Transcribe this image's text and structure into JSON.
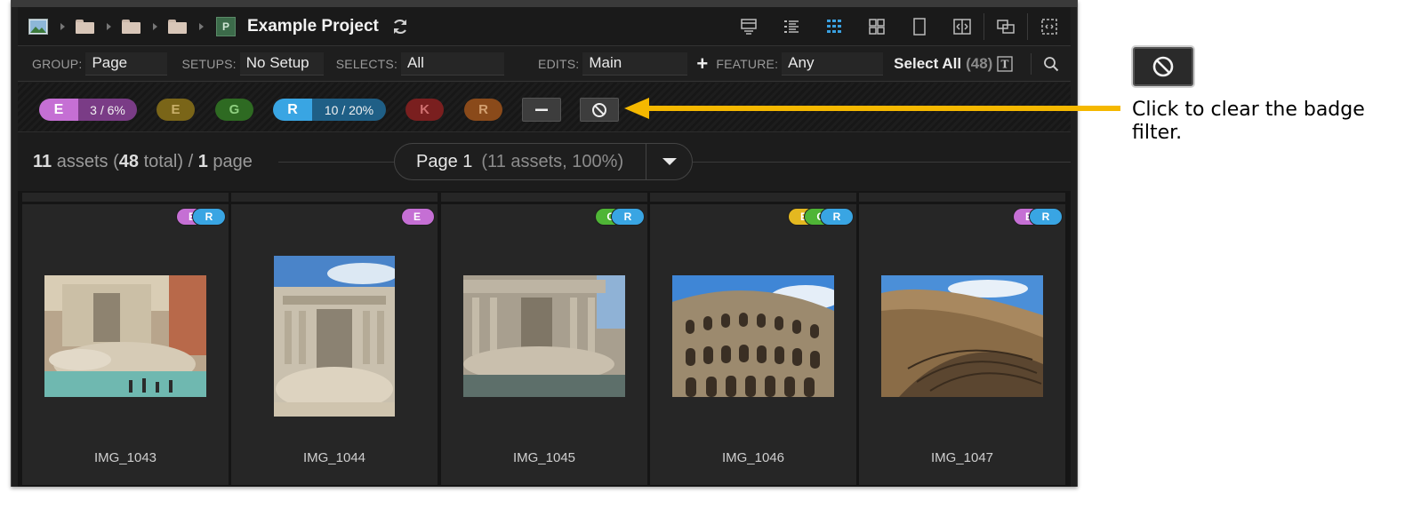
{
  "breadcrumb": {
    "project_badge": "P",
    "title": "Example Project"
  },
  "toolbar": {
    "group_label": "GROUP:",
    "group_value": "Page",
    "setups_label": "SETUPS:",
    "setups_value": "No Setup",
    "selects_label": "SELECTS:",
    "selects_value": "All",
    "edits_label": "EDITS:",
    "edits_value": "Main",
    "plus_label": "+",
    "feature_label": "FEATURE:",
    "feature_value": "Any",
    "select_all_label": "Select All",
    "select_all_count": "(48)",
    "text_icon_label": "T"
  },
  "badge_filters": [
    {
      "letter": "E",
      "stat": "3 / 6%",
      "color": "#c56fd4",
      "dark": "#7a3c86",
      "active": true
    },
    {
      "letter": "E",
      "color": "#7a6518",
      "text_color": "#c9b06a",
      "active": false
    },
    {
      "letter": "G",
      "color": "#2e6a22",
      "text_color": "#8fcf80",
      "active": false
    },
    {
      "letter": "R",
      "stat": "10 / 20%",
      "color": "#39a5e3",
      "dark": "#1f5f86",
      "active": true
    },
    {
      "letter": "K",
      "color": "#7a1f1f",
      "text_color": "#d07070",
      "active": false
    },
    {
      "letter": "R",
      "color": "#8a4a1a",
      "text_color": "#d3a070",
      "active": false
    }
  ],
  "summary": {
    "assets": "11",
    "assets_word": "assets",
    "total": "48",
    "total_word": "total",
    "pages": "1",
    "pages_word": "page"
  },
  "page_selector": {
    "label": "Page 1",
    "info": "(11 assets, 100%)"
  },
  "assets": [
    {
      "name": "IMG_1043",
      "badges": [
        {
          "letter": "E",
          "color": "#c56fd4"
        },
        {
          "letter": "R",
          "color": "#39a5e3"
        }
      ]
    },
    {
      "name": "IMG_1044",
      "badges": [
        {
          "letter": "E",
          "color": "#c56fd4"
        }
      ]
    },
    {
      "name": "IMG_1045",
      "badges": [
        {
          "letter": "G",
          "color": "#4fb536"
        },
        {
          "letter": "R",
          "color": "#39a5e3"
        }
      ]
    },
    {
      "name": "IMG_1046",
      "badges": [
        {
          "letter": "E",
          "color": "#e4b820"
        },
        {
          "letter": "G",
          "color": "#4fb536"
        },
        {
          "letter": "R",
          "color": "#39a5e3"
        }
      ]
    },
    {
      "name": "IMG_1047",
      "badges": [
        {
          "letter": "E",
          "color": "#c56fd4"
        },
        {
          "letter": "R",
          "color": "#39a5e3"
        }
      ]
    }
  ],
  "callout": {
    "text": "Click to clear the badge filter.",
    "arrow_color": "#f5b800"
  }
}
